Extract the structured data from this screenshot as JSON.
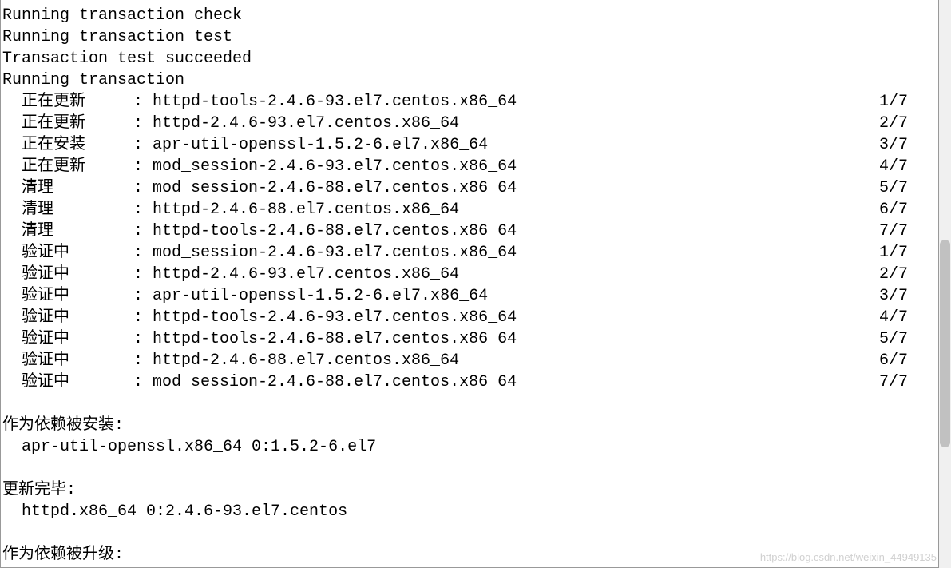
{
  "header": [
    "Running transaction check",
    "Running transaction test",
    "Transaction test succeeded",
    "Running transaction"
  ],
  "transactions": [
    {
      "action": "正在更新",
      "package": "httpd-tools-2.4.6-93.el7.centos.x86_64",
      "progress": "1/7"
    },
    {
      "action": "正在更新",
      "package": "httpd-2.4.6-93.el7.centos.x86_64",
      "progress": "2/7"
    },
    {
      "action": "正在安装",
      "package": "apr-util-openssl-1.5.2-6.el7.x86_64",
      "progress": "3/7"
    },
    {
      "action": "正在更新",
      "package": "mod_session-2.4.6-93.el7.centos.x86_64",
      "progress": "4/7"
    },
    {
      "action": "清理",
      "package": "mod_session-2.4.6-88.el7.centos.x86_64",
      "progress": "5/7"
    },
    {
      "action": "清理",
      "package": "httpd-2.4.6-88.el7.centos.x86_64",
      "progress": "6/7"
    },
    {
      "action": "清理",
      "package": "httpd-tools-2.4.6-88.el7.centos.x86_64",
      "progress": "7/7"
    },
    {
      "action": "验证中",
      "package": "mod_session-2.4.6-93.el7.centos.x86_64",
      "progress": "1/7"
    },
    {
      "action": "验证中",
      "package": "httpd-2.4.6-93.el7.centos.x86_64",
      "progress": "2/7"
    },
    {
      "action": "验证中",
      "package": "apr-util-openssl-1.5.2-6.el7.x86_64",
      "progress": "3/7"
    },
    {
      "action": "验证中",
      "package": "httpd-tools-2.4.6-93.el7.centos.x86_64",
      "progress": "4/7"
    },
    {
      "action": "验证中",
      "package": "httpd-tools-2.4.6-88.el7.centos.x86_64",
      "progress": "5/7"
    },
    {
      "action": "验证中",
      "package": "httpd-2.4.6-88.el7.centos.x86_64",
      "progress": "6/7"
    },
    {
      "action": "验证中",
      "package": "mod_session-2.4.6-88.el7.centos.x86_64",
      "progress": "7/7"
    }
  ],
  "installed_as_dependency": {
    "label": "作为依赖被安装:",
    "packages": [
      "apr-util-openssl.x86_64 0:1.5.2-6.el7"
    ]
  },
  "update_complete": {
    "label": "更新完毕:",
    "packages": [
      "httpd.x86_64 0:2.4.6-93.el7.centos"
    ]
  },
  "upgraded_as_dependency": {
    "label": "作为依赖被升级:"
  },
  "watermark": "https://blog.csdn.net/weixin_44949135"
}
